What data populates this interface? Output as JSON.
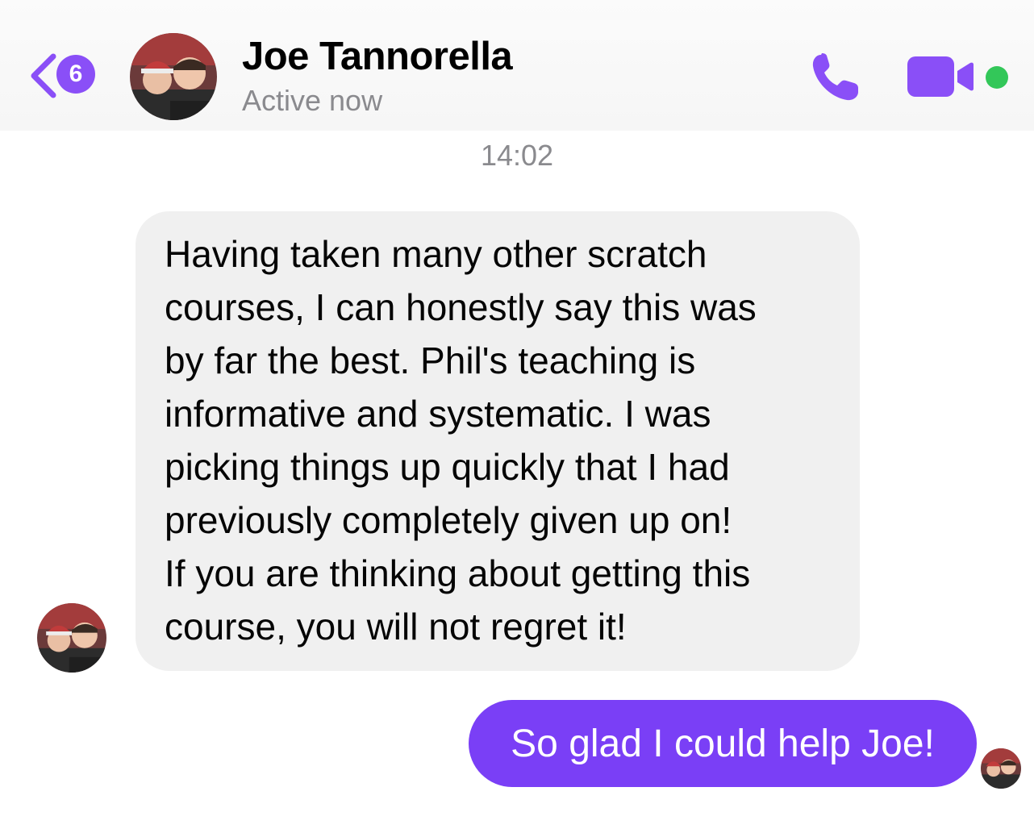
{
  "header": {
    "back_badge_count": "6",
    "contact_name": "Joe Tannorella",
    "status": "Active now",
    "icons": [
      "chevron-left-icon",
      "phone-icon",
      "video-camera-icon",
      "online-dot"
    ],
    "accent_color": "#7a3ff6",
    "online_color": "#33c759"
  },
  "thread": {
    "timestamp": "14:02",
    "messages": [
      {
        "from": "contact",
        "lines": [
          "Having taken many other scratch",
          "courses, I can honestly say this was",
          "by far the best. Phil's teaching is",
          "informative and systematic. I was",
          "picking things up quickly that I had",
          "previously completely given up on!",
          "If you are thinking about getting this",
          "course, you will not regret it!"
        ]
      },
      {
        "from": "me",
        "text": "So glad I could help Joe!"
      }
    ]
  }
}
